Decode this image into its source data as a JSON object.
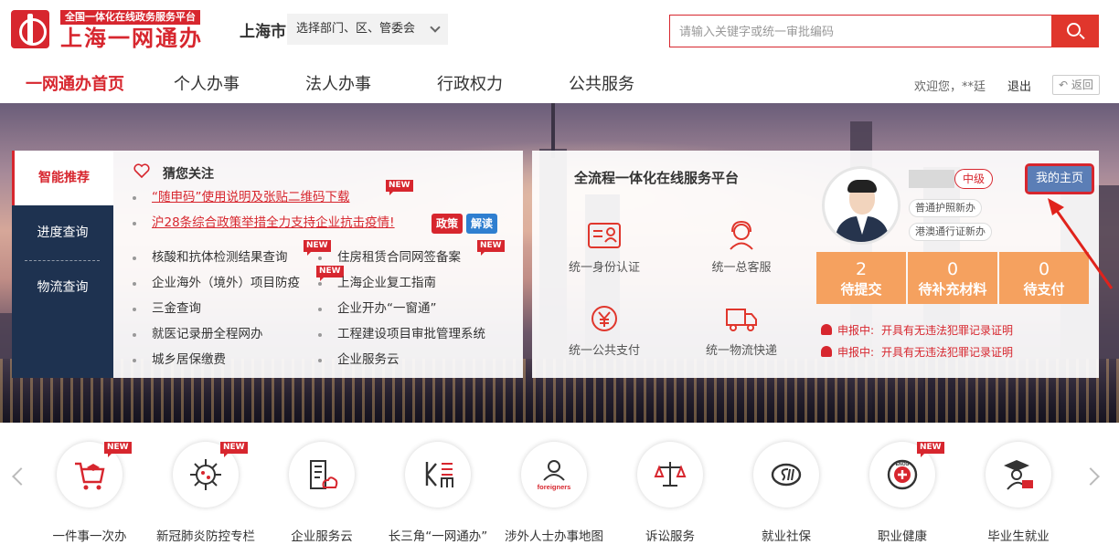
{
  "header": {
    "logo_tag": "全国一体化在线政务服务平台",
    "logo_title": "上海一网通办",
    "city": "上海市",
    "dept_select": "选择部门、区、管委会",
    "search_placeholder": "请输入关键字或统一审批编码"
  },
  "nav": {
    "items": [
      {
        "label": "一网通办首页"
      },
      {
        "label": "个人办事"
      },
      {
        "label": "法人办事"
      },
      {
        "label": "行政权力"
      },
      {
        "label": "公共服务"
      }
    ],
    "welcome": "欢迎您，**廷",
    "logout": "退出",
    "back": "返回"
  },
  "tabs": [
    {
      "label": "智能推荐"
    },
    {
      "label": "进度查询"
    },
    {
      "label": "物流查询"
    }
  ],
  "recommend": {
    "title": "猜您关注",
    "new_label": "NEW",
    "policy_tag": "政策",
    "explain_tag": "解读",
    "hot_links": [
      "“随申码”使用说明及张贴二维码下载",
      "沪28条综合政策举措全力支持企业抗击疫情!"
    ],
    "links": [
      "核酸和抗体检测结果查询",
      "住房租赁合同网签备案",
      "企业海外（境外）项目防疫",
      "上海企业复工指南",
      "三金查询",
      "企业开办“一窗通”",
      "就医记录册全程网办",
      "工程建设项目审批管理系统",
      "城乡居保缴费",
      "企业服务云"
    ]
  },
  "platform": {
    "title": "全流程一体化在线服务平台",
    "services": [
      {
        "label": "统一身份认证",
        "icon": "id-card-icon"
      },
      {
        "label": "统一总客服",
        "icon": "customer-service-icon"
      },
      {
        "label": "统一公共支付",
        "icon": "payment-icon"
      },
      {
        "label": "统一物流快递",
        "icon": "delivery-truck-icon"
      }
    ],
    "level": "中级",
    "home_button": "我的主页",
    "service_tags": [
      "普通护照新办",
      "港澳通行证新办"
    ],
    "stats": [
      {
        "num": "2",
        "label": "待提交"
      },
      {
        "num": "0",
        "label": "待补充材料"
      },
      {
        "num": "0",
        "label": "待支付"
      }
    ],
    "alerts": [
      {
        "status": "申报中:",
        "content": "开具有无违法犯罪记录证明"
      },
      {
        "status": "申报中:",
        "content": "开具有无违法犯罪记录证明"
      }
    ]
  },
  "quick_access": [
    {
      "label": "一件事一次办",
      "icon": "shopping-cart-icon",
      "new": true
    },
    {
      "label": "新冠肺炎防控专栏",
      "icon": "virus-icon",
      "new": true
    },
    {
      "label": "企业服务云",
      "icon": "building-cloud-icon",
      "new": false
    },
    {
      "label": "长三角“一网通办”",
      "icon": "yangtze-delta-icon",
      "new": false
    },
    {
      "label": "涉外人士办事地图",
      "icon": "foreigners-icon",
      "text": "foreigners",
      "new": false
    },
    {
      "label": "诉讼服务",
      "icon": "scales-icon",
      "new": false
    },
    {
      "label": "就业社保",
      "icon": "social-insurance-icon",
      "new": false
    },
    {
      "label": "职业健康",
      "icon": "occupational-health-icon",
      "text": "ENOG",
      "new": true
    },
    {
      "label": "毕业生就业",
      "icon": "graduate-icon",
      "new": false
    }
  ],
  "colors": {
    "brand_red": "#d7262e",
    "navy": "#1e3250",
    "stat_orange": "#f5a15f",
    "home_blue": "#5b7eb6"
  }
}
